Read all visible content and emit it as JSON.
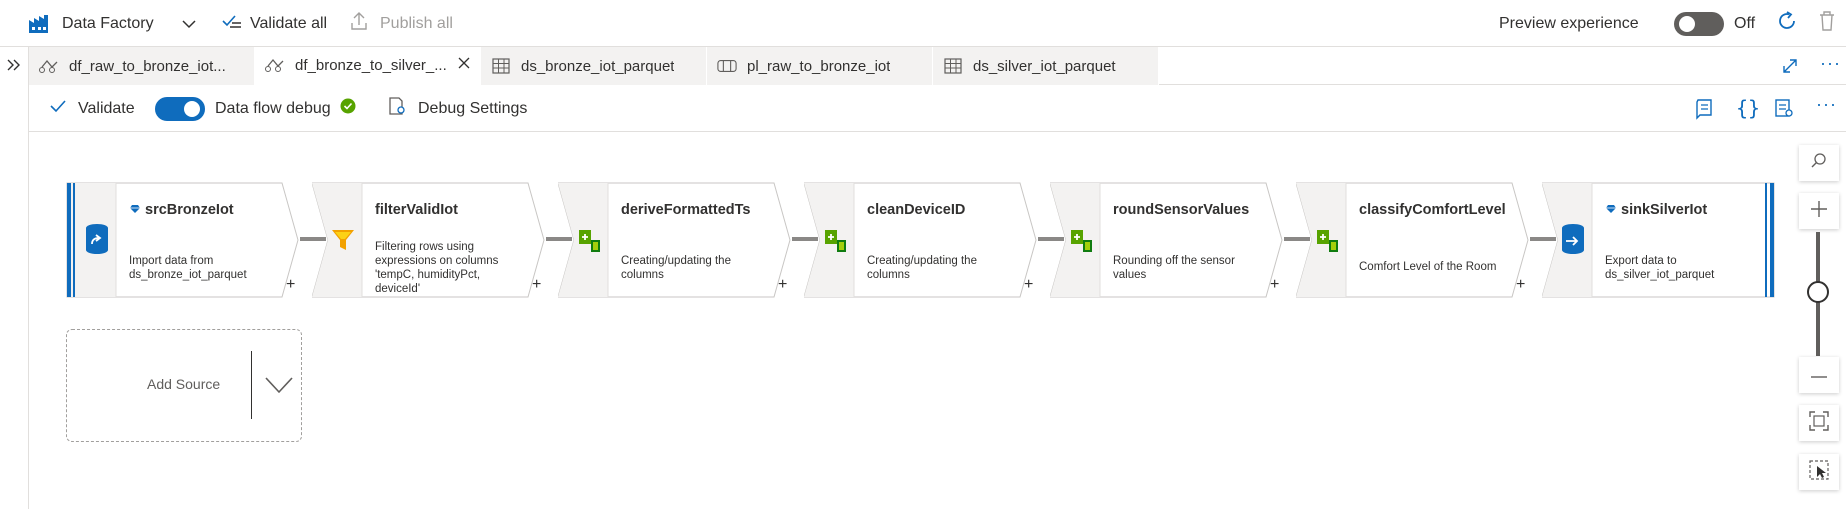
{
  "topbar": {
    "app_name": "Data Factory",
    "validate_all": "Validate all",
    "publish_all": "Publish all",
    "preview_experience": "Preview experience",
    "preview_state": "Off"
  },
  "tabs": [
    {
      "label": "df_raw_to_bronze_iot...",
      "icon": "dataflow-icon"
    },
    {
      "label": "df_bronze_to_silver_...",
      "icon": "dataflow-icon",
      "active": true
    },
    {
      "label": "ds_bronze_iot_parquet",
      "icon": "table-icon"
    },
    {
      "label": "pl_raw_to_bronze_iot",
      "icon": "pipeline-icon"
    },
    {
      "label": "ds_silver_iot_parquet",
      "icon": "table-icon"
    }
  ],
  "commands": {
    "validate": "Validate",
    "data_flow_debug": "Data flow debug",
    "debug_settings": "Debug Settings"
  },
  "nodes": [
    {
      "title": "srcBronzeIot",
      "desc": [
        "Import data from",
        "ds_bronze_iot_parquet"
      ],
      "type": "source"
    },
    {
      "title": "filterValidIot",
      "desc": [
        "Filtering rows using",
        "expressions on columns",
        "'tempC, humidityPct,",
        "deviceId'"
      ],
      "type": "filter"
    },
    {
      "title": "deriveFormattedTs",
      "desc": [
        "Creating/updating the",
        "columns"
      ],
      "type": "derive"
    },
    {
      "title": "cleanDeviceID",
      "desc": [
        "Creating/updating the",
        "columns"
      ],
      "type": "derive"
    },
    {
      "title": "roundSensorValues",
      "desc": [
        "Rounding off the sensor",
        "values"
      ],
      "type": "derive"
    },
    {
      "title": "classifyComfortLevel",
      "desc": [
        "Comfort Level of the Room"
      ],
      "type": "derive"
    },
    {
      "title": "sinkSilverIot",
      "desc": [
        "Export data to",
        "ds_silver_iot_parquet"
      ],
      "type": "sink"
    }
  ],
  "add_source": "Add Source",
  "zoom": {
    "level": 0.5
  }
}
